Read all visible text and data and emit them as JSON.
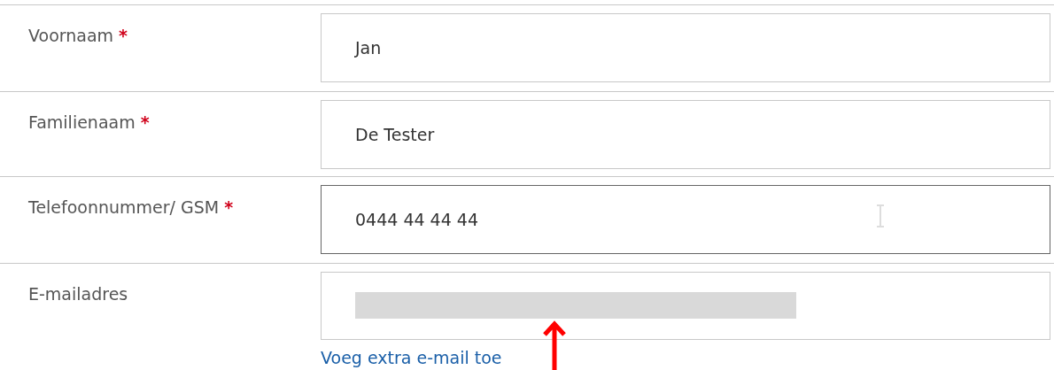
{
  "fields": [
    {
      "label": "Voornaam",
      "required": true,
      "value": "Jan",
      "focused": false,
      "hovered": false,
      "redacted": false
    },
    {
      "label": "Familienaam",
      "required": true,
      "value": "De Tester",
      "focused": false,
      "hovered": false,
      "redacted": false
    },
    {
      "label": "Telefoonnummer/ GSM",
      "required": true,
      "value": "0444 44 44 44",
      "focused": true,
      "hovered": true,
      "redacted": false
    },
    {
      "label": "E-mailadres",
      "required": false,
      "redacted": true,
      "focused": false,
      "hovered": false,
      "link": "Voeg extra e-mail toe"
    }
  ],
  "required_mark": "*",
  "annotation": {
    "kind": "arrow"
  }
}
